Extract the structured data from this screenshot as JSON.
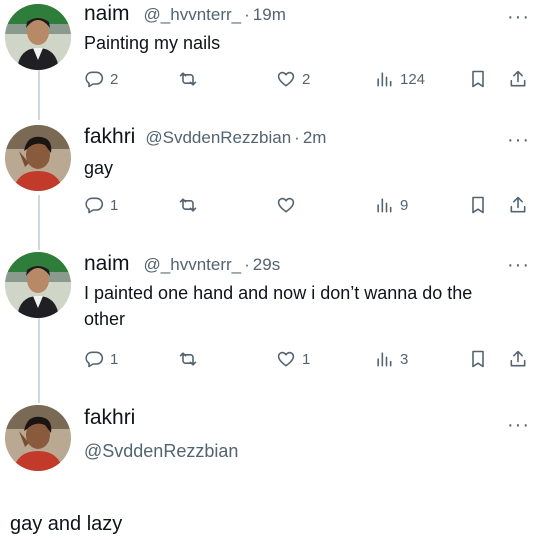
{
  "tweets": [
    {
      "name": "naim",
      "handle": "@_hvvnterr_",
      "time": "19m",
      "text": "Painting my nails",
      "stats": {
        "replies": "2",
        "retweets": "",
        "likes": "2",
        "views": "124"
      },
      "avatar": "avatar-naim"
    },
    {
      "name": "fakhri",
      "handle": "@SvddenRezzbian",
      "time": "2m",
      "text": "gay",
      "stats": {
        "replies": "1",
        "retweets": "",
        "likes": "",
        "views": "9"
      },
      "avatar": "avatar-fakhri"
    },
    {
      "name": "naim",
      "handle": "@_hvvnterr_",
      "time": "29s",
      "text": "I painted one hand and now i don’t wanna do the other",
      "stats": {
        "replies": "1",
        "retweets": "",
        "likes": "1",
        "views": "3"
      },
      "avatar": "avatar-naim"
    }
  ],
  "reply_compose": {
    "name": "fakhri",
    "handle": "@SvddenRezzbian",
    "text": "gay and lazy"
  },
  "separator": "·",
  "more_glyph": "···",
  "icons": [
    "reply-icon",
    "retweet-icon",
    "like-icon",
    "views-icon",
    "bookmark-icon",
    "share-icon",
    "more-icon"
  ]
}
